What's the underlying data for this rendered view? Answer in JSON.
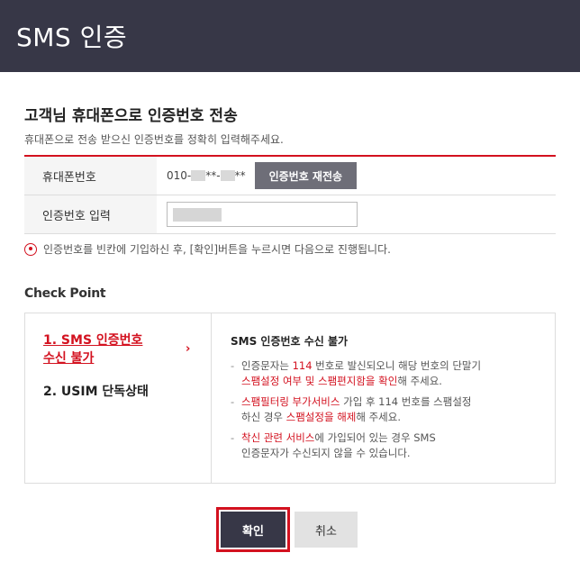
{
  "window": {
    "title": "SMS 인증"
  },
  "section": {
    "heading": "고객님 휴대폰으로 인증번호 전송",
    "subtext": "휴대폰으로 전송 받으신 인증번호를 정확히 입력해주세요."
  },
  "form": {
    "phone_label": "휴대폰번호",
    "phone_prefix": "010-",
    "phone_mid": "**-",
    "phone_tail": "**",
    "resend_label": "인증번호 재전송",
    "code_label": "인증번호 입력"
  },
  "notice": {
    "text": "인증번호를 빈칸에 기입하신 후, [확인]버튼을 누르시면 다음으로 진행됩니다."
  },
  "checkpoint": {
    "title": "Check Point",
    "items": [
      {
        "label_line1": "1. SMS 인증번호",
        "label_line2": "수신 불가"
      },
      {
        "label": "2. USIM 단독상태"
      }
    ],
    "chevron": "›",
    "detail_title": "SMS 인증번호 수신 불가",
    "lines": {
      "l1_a": "인증문자는 ",
      "l1_b": "114",
      "l1_c": " 번호로 발신되오니 해당 번호의 단말기",
      "l1_d": "스팸설정 여부 및 스팸편지함을 확인",
      "l1_e": "해 주세요.",
      "l2_a": "스팸필터링 부가서비스",
      "l2_b": " 가입 후 114 번호를 스팸설정",
      "l2_c": "하신 경우 ",
      "l2_d": "스팸설정을 해제",
      "l2_e": "해 주세요.",
      "l3_a": "착신 관련 서비스",
      "l3_b": "에 가입되어 있는 경우 SMS",
      "l3_c": "인증문자가 수신되지 않을 수 있습니다."
    }
  },
  "actions": {
    "confirm_label": "확인",
    "cancel_label": "취소"
  },
  "colors": {
    "accent": "#d3111f",
    "header_bg": "#373747",
    "button_gray": "#6e6e78"
  }
}
